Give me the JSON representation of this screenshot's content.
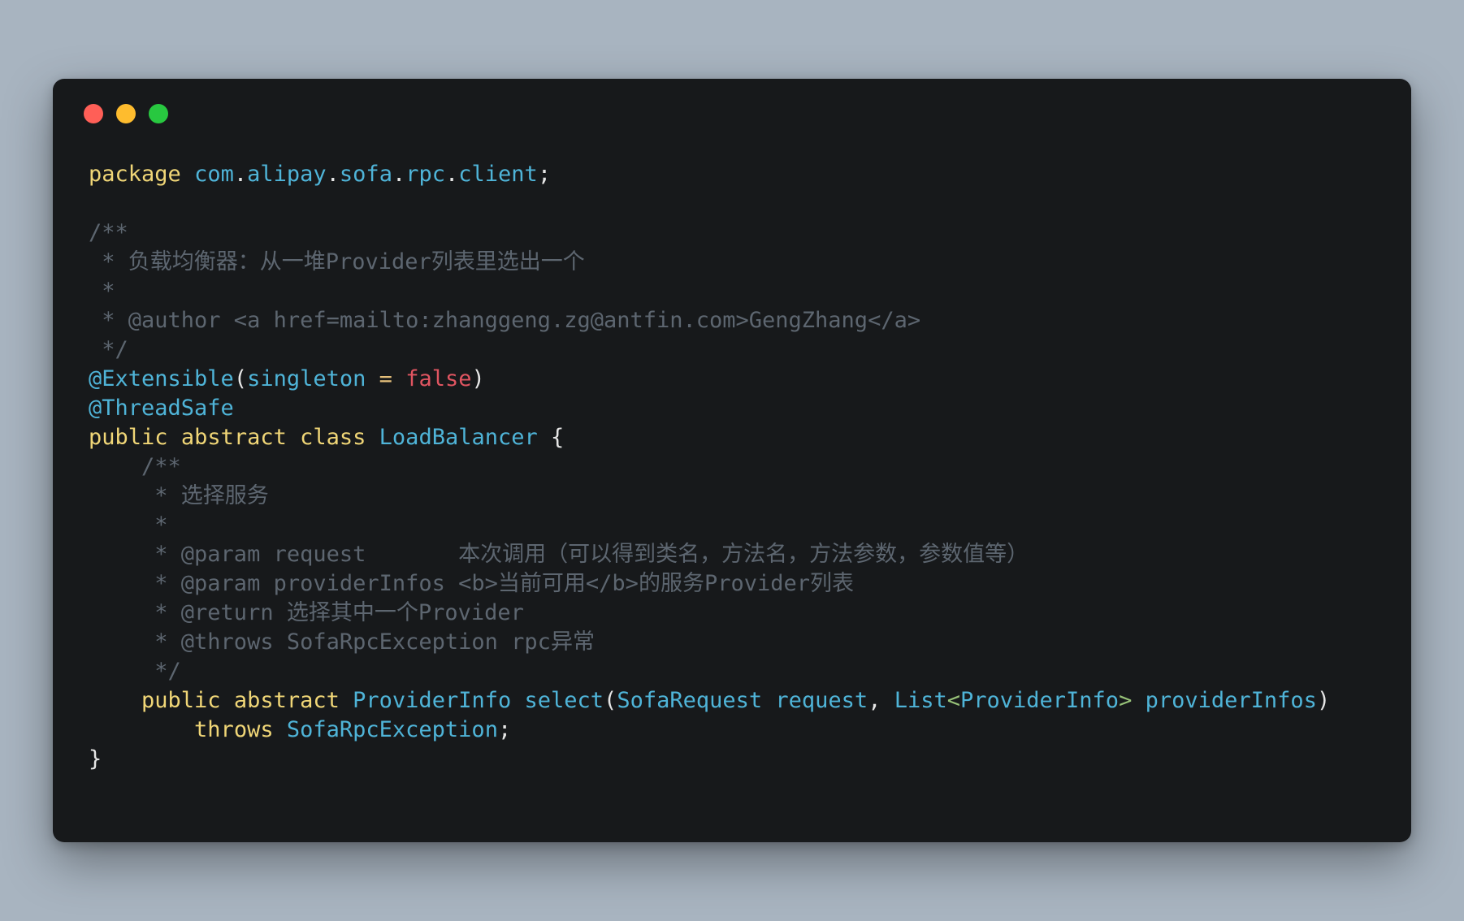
{
  "colors": {
    "background": "#a8b4c0",
    "window": "#17191b",
    "keyword": "#f0d677",
    "identifier": "#4fb4d8",
    "comment": "#5d6670",
    "literal": "#e05561",
    "operator": "#e6c07b",
    "punctuation": "#e6e6e6",
    "type_param": "#98c379"
  },
  "window": {
    "buttons": [
      {
        "name": "close",
        "color": "#ff5f57"
      },
      {
        "name": "minimize",
        "color": "#febc2e"
      },
      {
        "name": "maximize",
        "color": "#28c840"
      }
    ]
  },
  "code_lines": [
    [
      [
        "package",
        "keyword"
      ],
      [
        " ",
        "plain"
      ],
      [
        "com",
        "identifier"
      ],
      [
        ".",
        "plain"
      ],
      [
        "alipay",
        "identifier"
      ],
      [
        ".",
        "plain"
      ],
      [
        "sofa",
        "identifier"
      ],
      [
        ".",
        "plain"
      ],
      [
        "rpc",
        "identifier"
      ],
      [
        ".",
        "plain"
      ],
      [
        "client",
        "identifier"
      ],
      [
        ";",
        "plain"
      ]
    ],
    [],
    [
      [
        "/**",
        "comment"
      ]
    ],
    [
      [
        " * 负载均衡器：从一堆Provider列表里选出一个",
        "comment"
      ]
    ],
    [
      [
        " *",
        "comment"
      ]
    ],
    [
      [
        " * @author <a href=mailto:zhanggeng.zg@antfin.com>GengZhang</a>",
        "comment"
      ]
    ],
    [
      [
        " */",
        "comment"
      ]
    ],
    [
      [
        "@Extensible",
        "identifier"
      ],
      [
        "(",
        "plain"
      ],
      [
        "singleton",
        "identifier"
      ],
      [
        " ",
        "plain"
      ],
      [
        "=",
        "operator"
      ],
      [
        " ",
        "plain"
      ],
      [
        "false",
        "literal"
      ],
      [
        ")",
        "plain"
      ]
    ],
    [
      [
        "@ThreadSafe",
        "identifier"
      ]
    ],
    [
      [
        "public",
        "keyword"
      ],
      [
        " ",
        "plain"
      ],
      [
        "abstract",
        "keyword"
      ],
      [
        " ",
        "plain"
      ],
      [
        "class",
        "keyword"
      ],
      [
        " ",
        "plain"
      ],
      [
        "LoadBalancer",
        "identifier"
      ],
      [
        " {",
        "plain"
      ]
    ],
    [
      [
        "    /**",
        "comment"
      ]
    ],
    [
      [
        "     * 选择服务",
        "comment"
      ]
    ],
    [
      [
        "     *",
        "comment"
      ]
    ],
    [
      [
        "     * @param request       本次调用（可以得到类名，方法名，方法参数，参数值等）",
        "comment"
      ]
    ],
    [
      [
        "     * @param providerInfos <b>当前可用</b>的服务Provider列表",
        "comment"
      ]
    ],
    [
      [
        "     * @return 选择其中一个Provider",
        "comment"
      ]
    ],
    [
      [
        "     * @throws SofaRpcException rpc异常",
        "comment"
      ]
    ],
    [
      [
        "     */",
        "comment"
      ]
    ],
    [
      [
        "    ",
        "plain"
      ],
      [
        "public",
        "keyword"
      ],
      [
        " ",
        "plain"
      ],
      [
        "abstract",
        "keyword"
      ],
      [
        " ",
        "plain"
      ],
      [
        "ProviderInfo",
        "identifier"
      ],
      [
        " ",
        "plain"
      ],
      [
        "select",
        "identifier"
      ],
      [
        "(",
        "plain"
      ],
      [
        "SofaRequest",
        "identifier"
      ],
      [
        " ",
        "plain"
      ],
      [
        "request",
        "identifier"
      ],
      [
        ", ",
        "plain"
      ],
      [
        "List",
        "identifier"
      ],
      [
        "<",
        "type_param"
      ],
      [
        "ProviderInfo",
        "identifier"
      ],
      [
        ">",
        "type_param"
      ],
      [
        " ",
        "plain"
      ],
      [
        "providerInfos",
        "identifier"
      ],
      [
        ")",
        "plain"
      ]
    ],
    [
      [
        "        ",
        "plain"
      ],
      [
        "throws",
        "keyword"
      ],
      [
        " ",
        "plain"
      ],
      [
        "SofaRpcException",
        "identifier"
      ],
      [
        ";",
        "plain"
      ]
    ],
    [
      [
        "}",
        "plain"
      ]
    ]
  ]
}
